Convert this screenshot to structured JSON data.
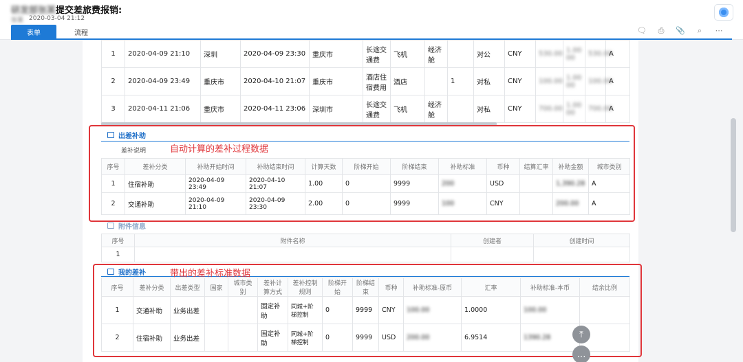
{
  "header": {
    "title_prefix_blurred": "研发部张某",
    "title": "提交差旅费报销:",
    "applicant_blurred": "张某",
    "date": "2020-03-04 21:12",
    "tabs": [
      {
        "label": "表单"
      },
      {
        "label": "流程"
      }
    ],
    "toolbar_icons": [
      "comment-icon",
      "print-icon",
      "attach-icon",
      "search-icon",
      "more-icon"
    ]
  },
  "expense_table": {
    "rows": [
      {
        "no": "1",
        "start": "2020-04-09 21:10",
        "from": "深圳",
        "end": "2020-04-09 23:30",
        "to": "重庆市",
        "category": "长途交通费",
        "type": "飞机",
        "class": "经济舱",
        "days": "",
        "settle": "对公",
        "currency": "CNY",
        "amount_blurred": "530.00",
        "rate_blurred": "1.00 00",
        "total_blurred": "530.00",
        "city": "A"
      },
      {
        "no": "2",
        "start": "2020-04-09 23:49",
        "from": "重庆市",
        "end": "2020-04-10 21:07",
        "to": "重庆市",
        "category": "酒店住宿费用",
        "type": "酒店",
        "class": "",
        "days": "1",
        "settle": "对私",
        "currency": "CNY",
        "amount_blurred": "100.00",
        "rate_blurred": "1.00 00",
        "total_blurred": "100.00",
        "city": "A"
      },
      {
        "no": "3",
        "start": "2020-04-11 21:06",
        "from": "重庆市",
        "end": "2020-04-11 23:06",
        "to": "深圳市",
        "category": "长途交通费",
        "type": "飞机",
        "class": "经济舱",
        "days": "",
        "settle": "对私",
        "currency": "CNY",
        "amount_blurred": "700.00",
        "rate_blurred": "1.00 00",
        "total_blurred": "700.00",
        "city": "A"
      }
    ]
  },
  "allowance": {
    "section_title": "出差补助",
    "note_label": "差补说明",
    "annotation": "自动计算的差补过程数据",
    "columns": [
      "序号",
      "差补分类",
      "补助开始时间",
      "补助结束时间",
      "计算天数",
      "阶梯开始",
      "阶梯结束",
      "补助标准",
      "币种",
      "结算汇率",
      "补助金额",
      "城市类别"
    ],
    "rows": [
      {
        "no": "1",
        "category": "住宿补助",
        "start": "2020-04-09 23:49",
        "end": "2020-04-10 21:07",
        "days": "1.00",
        "step_start": "0",
        "step_end": "9999",
        "standard_blurred": "200",
        "currency": "USD",
        "rate": "",
        "amount_blurred": "1,390.28",
        "city": "A"
      },
      {
        "no": "2",
        "category": "交通补助",
        "start": "2020-04-09 21:10",
        "end": "2020-04-09 23:30",
        "days": "2.00",
        "step_start": "0",
        "step_end": "9999",
        "standard_blurred": "100",
        "currency": "CNY",
        "rate": "",
        "amount_blurred": "200.00",
        "city": "A"
      }
    ]
  },
  "attachments": {
    "section_title": "附件信息",
    "columns": [
      "序号",
      "附件名称",
      "创建者",
      "创建时间"
    ],
    "rows": [
      {
        "no": "1",
        "name": "",
        "creator": "",
        "time": ""
      }
    ]
  },
  "my_allowance": {
    "section_title": "我的差补",
    "annotation": "带出的差补标准数据",
    "columns": [
      "序号",
      "差补分类",
      "出差类型",
      "国家",
      "城市类别",
      "差补计算方式",
      "差补控制规则",
      "阶梯开始",
      "阶梯结束",
      "币种",
      "补助标准-原币",
      "汇率",
      "补助标准-本币",
      "结余比例"
    ],
    "rows": [
      {
        "no": "1",
        "category": "交通补助",
        "trip_type": "业务出差",
        "country": "",
        "city": "",
        "calc": "固定补助",
        "rule": "同城+阶梯控制",
        "step_start": "0",
        "step_end": "9999",
        "currency": "CNY",
        "std_orig_blurred": "100.00",
        "rate": "1.0000",
        "std_local_blurred": "100.00",
        "balance": ""
      },
      {
        "no": "2",
        "category": "住宿补助",
        "trip_type": "业务出差",
        "country": "",
        "city": "",
        "calc": "固定补助",
        "rule": "同城+阶梯控制",
        "step_start": "0",
        "step_end": "9999",
        "currency": "USD",
        "std_orig_blurred": "200.00",
        "rate": "6.9514",
        "std_local_blurred": "1390.28",
        "balance": ""
      }
    ]
  },
  "colors": {
    "accent": "#1e7ad6",
    "annotation_red": "#e0353a"
  }
}
